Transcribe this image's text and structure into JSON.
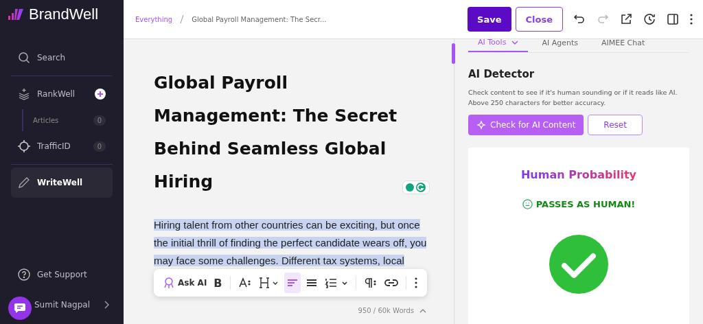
{
  "brand": {
    "name": "BrandWell"
  },
  "sidebar": {
    "items": [
      {
        "kind": "search",
        "label": "Search",
        "selected": false
      },
      {
        "kind": "add",
        "label": "RankWell",
        "selected": false
      },
      {
        "kind": "sub",
        "label": "Articles",
        "count": "0",
        "selected": false
      },
      {
        "kind": "count",
        "label": "TrafficID",
        "count": "0",
        "selected": false
      },
      {
        "kind": "plain",
        "label": "WriteWell",
        "selected": true
      }
    ],
    "support": "Get Support",
    "user": "Sumit Nagpal"
  },
  "breadcrumb": [
    "Everything",
    "Global Payroll Management: The Secr..."
  ],
  "header_buttons": {
    "save": "Save",
    "close": "Close"
  },
  "editor": {
    "title": "Global Payroll Management: The Secret Behind Seamless Global Hiring",
    "paragraph": "Hiring talent from other countries can be exciting, but once the initial thrill of finding the perfect candidate wears off, you may face some challenges. Different tax systems, local",
    "toolbar": [
      {
        "kind": "ask",
        "label": "Ask AI",
        "selected": false
      },
      {
        "kind": "bold",
        "label": "B",
        "selected": false
      },
      {
        "kind": "sep"
      },
      {
        "kind": "fontsize",
        "selected": false
      },
      {
        "kind": "heading",
        "selected": false
      },
      {
        "kind": "align-left",
        "selected": true
      },
      {
        "kind": "justify",
        "selected": false
      },
      {
        "kind": "list",
        "selected": false
      },
      {
        "kind": "sep"
      },
      {
        "kind": "paragraph",
        "selected": false
      },
      {
        "kind": "link",
        "selected": false
      },
      {
        "kind": "sep"
      },
      {
        "kind": "more",
        "selected": false
      }
    ],
    "word_count": "950 / 60k Words"
  },
  "panel": {
    "tabs": [
      {
        "label": "AI Tools",
        "selected": true
      },
      {
        "label": "AI Agents",
        "selected": false
      },
      {
        "label": "AIMEE Chat",
        "selected": false
      }
    ],
    "heading": "AI Detector",
    "description": "Check content to see if it's human sounding or if it reads like AI. Above 250 characters for better accuracy.",
    "check_button": "Check for AI Content",
    "reset_button": "Reset",
    "result": {
      "title": "Human Probability",
      "verdict": "PASSES AS HUMAN!"
    }
  }
}
